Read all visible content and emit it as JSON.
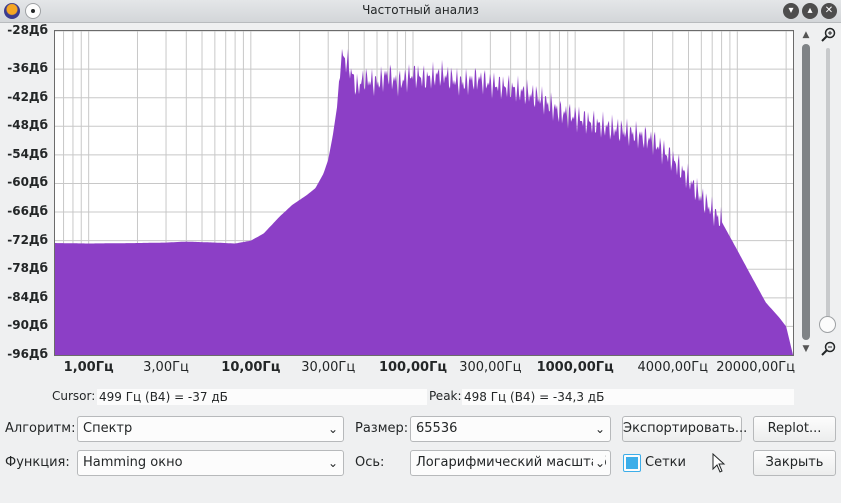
{
  "window": {
    "title": "Частотный анализ",
    "min_icon": "chevron-down-icon",
    "max_icon": "chevron-up-icon",
    "close_icon": "close-icon"
  },
  "plot": {
    "y_labels": [
      "-28Дб",
      "-36Дб",
      "-42Дб",
      "-48Дб",
      "-54Дб",
      "-60Дб",
      "-66Дб",
      "-72Дб",
      "-78Дб",
      "-84Дб",
      "-90Дб",
      "-96Дб"
    ],
    "x_labels": [
      "1,00Гц",
      "3,00Гц",
      "10,00Гц",
      "30,00Гц",
      "100,00Гц",
      "300,00Гц",
      "1000,00Гц",
      "4000,00Гц",
      "20000,00Гц"
    ],
    "spectrum_color": "#8c3fc6",
    "grid": true
  },
  "chart_data": {
    "type": "area",
    "x_scale": "log",
    "xlabel": "",
    "ylabel": "",
    "ylim": [
      -96,
      -28
    ],
    "xlim_hz": [
      0.62,
      22050
    ],
    "x_ticks": [
      1,
      3,
      10,
      30,
      100,
      300,
      1000,
      4000,
      20000
    ],
    "y_ticks": [
      -28,
      -36,
      -42,
      -48,
      -54,
      -60,
      -66,
      -72,
      -78,
      -84,
      -90,
      -96
    ],
    "series": [
      {
        "x": [
          0.62,
          1,
          2,
          3,
          4,
          6,
          8,
          10,
          12,
          15,
          18,
          22,
          25,
          28,
          30,
          32,
          34,
          36,
          40,
          45,
          50,
          60,
          70,
          80,
          100,
          120,
          150,
          200,
          250,
          300,
          400,
          500,
          600,
          800,
          1000,
          1200,
          1500,
          2000,
          2500,
          3000,
          4000,
          5000,
          6000,
          8000,
          10000,
          12000,
          15000,
          18000,
          20000,
          22050
        ],
        "y": [
          -72.5,
          -72.6,
          -72.5,
          -72.4,
          -72.2,
          -72.4,
          -72.6,
          -72,
          -70.5,
          -67,
          -64.5,
          -62.5,
          -61,
          -58,
          -55,
          -50,
          -44,
          -33,
          -35,
          -40,
          -38,
          -39,
          -37,
          -39,
          -37,
          -38,
          -37,
          -39,
          -38,
          -39,
          -40,
          -41,
          -42,
          -45,
          -46,
          -47,
          -48,
          -49,
          -50,
          -51,
          -55,
          -59,
          -63,
          -68,
          -74,
          -79,
          -85,
          -88,
          -90,
          -96
        ]
      }
    ]
  },
  "status": {
    "cursor_label": "Cursor:",
    "cursor_value": "499 Гц (B4) = -37 дБ",
    "peak_label": "Peak:",
    "peak_value": "498 Гц (B4) = -34,3 дБ"
  },
  "controls": {
    "algorithm_label": "Алгоритм:",
    "algorithm_value": "Спектр",
    "size_label": "Размер:",
    "size_value": "65536",
    "export_button": "Экспортировать...",
    "replot_button": "Replot...",
    "function_label": "Функция:",
    "function_value": "Hamming окно",
    "axis_label": "Ось:",
    "axis_value": "Логарифмический масштаб",
    "grid_checkbox_label": "Сетки",
    "grid_checked": true,
    "close_button": "Закрыть"
  }
}
